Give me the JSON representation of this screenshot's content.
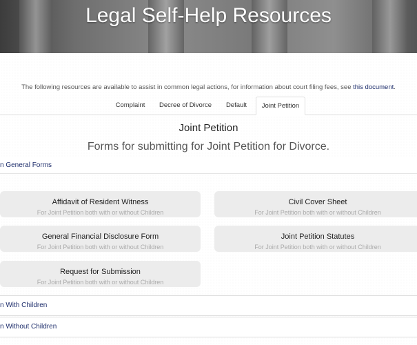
{
  "header": {
    "title": "Legal Self-Help Resources"
  },
  "intro": {
    "text": "The following resources are available to assist in common legal actions, for information about court filing fees, see ",
    "link_text": "this document",
    "suffix": "."
  },
  "tabs": [
    {
      "label": "Complaint"
    },
    {
      "label": "Decree of Divorce"
    },
    {
      "label": "Default"
    },
    {
      "label": "Joint Petition"
    }
  ],
  "section": {
    "title": "Joint Petition",
    "subtitle": "Forms for submitting for Joint Petition for Divorce."
  },
  "panels": {
    "general": "n General Forms",
    "with_children": "n With Children",
    "without_children": "n Without Children"
  },
  "cards": [
    {
      "title": "Affidavit of Resident Witness",
      "subtitle": "For Joint Petition both with or without Children"
    },
    {
      "title": "Civil Cover Sheet",
      "subtitle": "For Joint Petition both with or without Children"
    },
    {
      "title": "General Financial Disclosure Form",
      "subtitle": "For Joint Petition both with or without Children"
    },
    {
      "title": "Joint Petition Statutes",
      "subtitle": "For Joint Petition both with or without Children"
    },
    {
      "title": "Request for Submission",
      "subtitle": "For Joint Petition both with or without Children"
    }
  ],
  "colors": {
    "link": "#1d2d6b",
    "card_bg": "#ececec"
  }
}
